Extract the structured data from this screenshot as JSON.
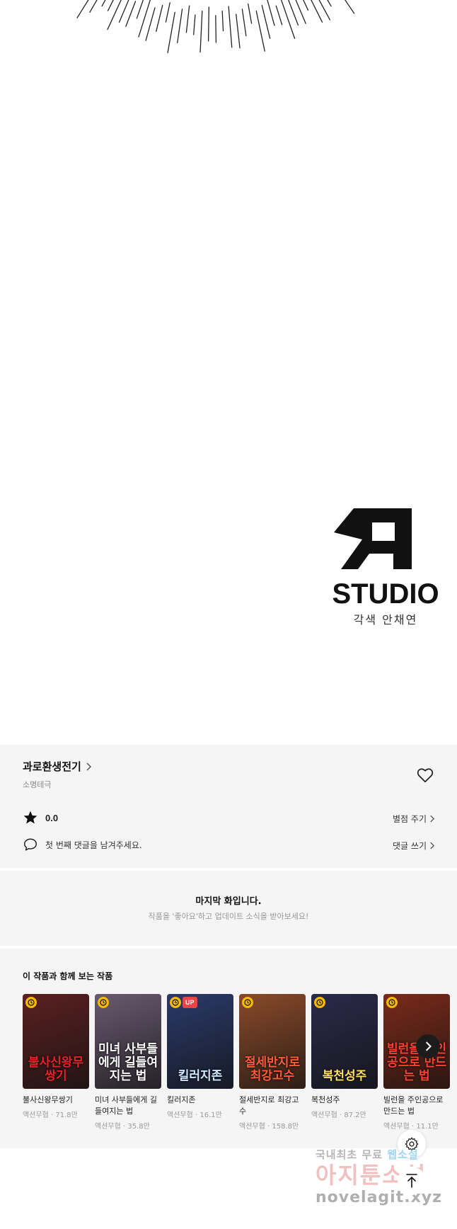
{
  "art": {
    "studio_wordmark": "STUDIO",
    "credits": "각색 안채연"
  },
  "series": {
    "title": "과로환생전기",
    "author": "소명테극",
    "rating": "0.0",
    "rate_action": "별점 주기",
    "comment_prompt": "첫 번째 댓글을 남겨주세요.",
    "comment_action": "댓글 쓰기"
  },
  "end_notice": {
    "title": "마지막 화입니다.",
    "subtitle": "작품을 '좋아요'하고 업데이트 소식을 받아보세요!"
  },
  "recommendations": {
    "heading": "이 작품과 함께 보는 작품",
    "items": [
      {
        "name": "불사신왕무쌍기",
        "genre": "액션무협",
        "views": "71.8만",
        "cover_text": "불사신왕무쌍기",
        "badge_up": "",
        "bg": "#5a2020",
        "fg": "#e8202a"
      },
      {
        "name": "미녀 사부들에게 길들여지는 법",
        "genre": "액션무협",
        "views": "35.8만",
        "cover_text": "미녀 사부들에게 길들여지는 법",
        "badge_up": "",
        "bg": "#6a5a70",
        "fg": "#ffffff"
      },
      {
        "name": "킬러지존",
        "genre": "액션무협",
        "views": "16.1만",
        "cover_text": "킬러지존",
        "badge_up": "UP",
        "bg": "#2a3a6a",
        "fg": "#d0e8ff"
      },
      {
        "name": "절세반지로 최강고수",
        "genre": "액션무협",
        "views": "158.8만",
        "cover_text": "절세반지로 최강고수",
        "badge_up": "",
        "bg": "#8a4a2a",
        "fg": "#ff5a3a"
      },
      {
        "name": "복천성주",
        "genre": "액션무협",
        "views": "87.2만",
        "cover_text": "복천성주",
        "badge_up": "",
        "bg": "#2a2a4a",
        "fg": "#ffe060"
      },
      {
        "name": "빌런을 주인공으로 만드는 법",
        "genre": "액션무협",
        "views": "11.1만",
        "cover_text": "빌런을 주인공으로 만드는 법",
        "badge_up": "",
        "bg": "#7a2a1a",
        "fg": "#ff4030"
      }
    ]
  },
  "watermark": {
    "line1_a": "국내최초 무료 ",
    "line1_b": "웹소설",
    "line2": "아지툰소설",
    "line3": "novelagit.xyz"
  },
  "icons": {
    "heart": "heart-icon",
    "star": "star-icon",
    "comment": "comment-icon",
    "chevron": "chevron-right-icon",
    "settings": "gear-icon",
    "scroll_top": "arrow-up-icon",
    "clock": "clock-icon"
  },
  "colors": {
    "panel_bg": "#f5f5f5",
    "badge_clock": "#f5b900",
    "badge_up": "#e94545"
  }
}
